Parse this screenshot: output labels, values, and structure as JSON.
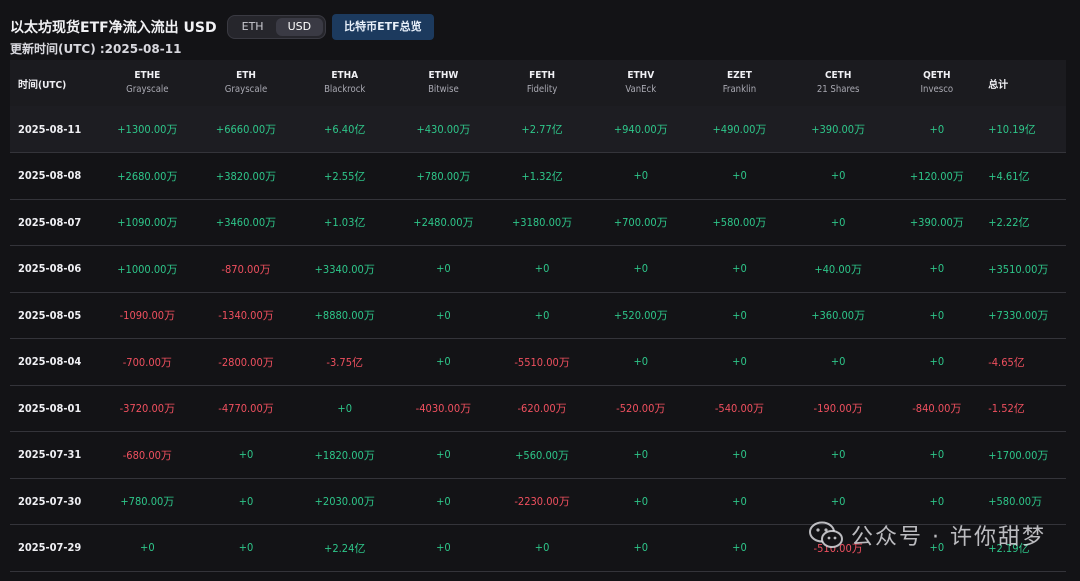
{
  "header": {
    "title": "以太坊现货ETF净流入流出 USD",
    "toggle": {
      "eth_label": "ETH",
      "usd_label": "USD",
      "active": "USD"
    },
    "overview_button": "比特币ETF总览",
    "updated": "更新时间(UTC) :2025-08-11"
  },
  "table": {
    "date_header": "时间(UTC)",
    "total_header": "总计",
    "funds": [
      {
        "code": "ETHE",
        "issuer": "Grayscale"
      },
      {
        "code": "ETH",
        "issuer": "Grayscale"
      },
      {
        "code": "ETHA",
        "issuer": "Blackrock"
      },
      {
        "code": "ETHW",
        "issuer": "Bitwise"
      },
      {
        "code": "FETH",
        "issuer": "Fidelity"
      },
      {
        "code": "ETHV",
        "issuer": "VanEck"
      },
      {
        "code": "EZET",
        "issuer": "Franklin"
      },
      {
        "code": "CETH",
        "issuer": "21 Shares"
      },
      {
        "code": "QETH",
        "issuer": "Invesco"
      }
    ],
    "rows": [
      {
        "date": "2025-08-11",
        "values": [
          "+1300.00万",
          "+6660.00万",
          "+6.40亿",
          "+430.00万",
          "+2.77亿",
          "+940.00万",
          "+490.00万",
          "+390.00万",
          "+0"
        ],
        "total": "+10.19亿"
      },
      {
        "date": "2025-08-08",
        "values": [
          "+2680.00万",
          "+3820.00万",
          "+2.55亿",
          "+780.00万",
          "+1.32亿",
          "+0",
          "+0",
          "+0",
          "+120.00万"
        ],
        "total": "+4.61亿"
      },
      {
        "date": "2025-08-07",
        "values": [
          "+1090.00万",
          "+3460.00万",
          "+1.03亿",
          "+2480.00万",
          "+3180.00万",
          "+700.00万",
          "+580.00万",
          "+0",
          "+390.00万"
        ],
        "total": "+2.22亿"
      },
      {
        "date": "2025-08-06",
        "values": [
          "+1000.00万",
          "-870.00万",
          "+3340.00万",
          "+0",
          "+0",
          "+0",
          "+0",
          "+40.00万",
          "+0"
        ],
        "total": "+3510.00万"
      },
      {
        "date": "2025-08-05",
        "values": [
          "-1090.00万",
          "-1340.00万",
          "+8880.00万",
          "+0",
          "+0",
          "+520.00万",
          "+0",
          "+360.00万",
          "+0"
        ],
        "total": "+7330.00万"
      },
      {
        "date": "2025-08-04",
        "values": [
          "-700.00万",
          "-2800.00万",
          "-3.75亿",
          "+0",
          "-5510.00万",
          "+0",
          "+0",
          "+0",
          "+0"
        ],
        "total": "-4.65亿"
      },
      {
        "date": "2025-08-01",
        "values": [
          "-3720.00万",
          "-4770.00万",
          "+0",
          "-4030.00万",
          "-620.00万",
          "-520.00万",
          "-540.00万",
          "-190.00万",
          "-840.00万"
        ],
        "total": "-1.52亿"
      },
      {
        "date": "2025-07-31",
        "values": [
          "-680.00万",
          "+0",
          "+1820.00万",
          "+0",
          "+560.00万",
          "+0",
          "+0",
          "+0",
          "+0"
        ],
        "total": "+1700.00万"
      },
      {
        "date": "2025-07-30",
        "values": [
          "+780.00万",
          "+0",
          "+2030.00万",
          "+0",
          "-2230.00万",
          "+0",
          "+0",
          "+0",
          "+0"
        ],
        "total": "+580.00万"
      },
      {
        "date": "2025-07-29",
        "values": [
          "+0",
          "+0",
          "+2.24亿",
          "+0",
          "+0",
          "+0",
          "+0",
          "-510.00万",
          "+0"
        ],
        "total": "+2.19亿"
      }
    ]
  },
  "watermark": {
    "text": "公众号 · 许你甜梦",
    "icon": "wechat-icon"
  },
  "colors": {
    "positive": "#2ec68a",
    "negative": "#f0505f",
    "background": "#131316",
    "accent_button": "#1c3a5e"
  }
}
